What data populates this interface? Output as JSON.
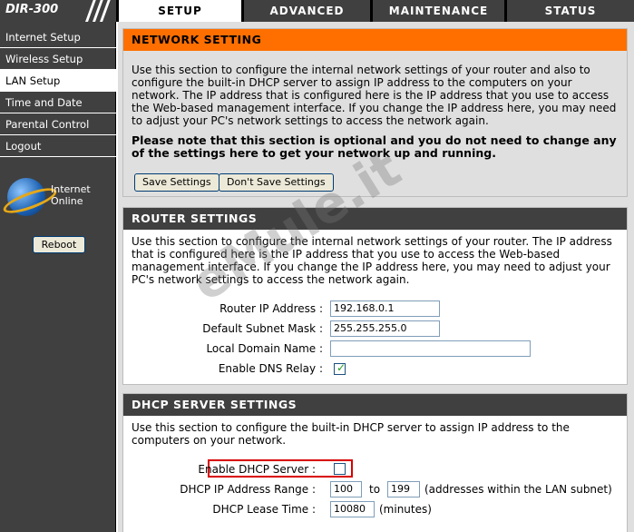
{
  "logo": "DIR-300",
  "tabs": [
    "SETUP",
    "ADVANCED",
    "MAINTENANCE",
    "STATUS"
  ],
  "sidebar": {
    "items": [
      "Internet Setup",
      "Wireless Setup",
      "LAN Setup",
      "Time and Date",
      "Parental Control",
      "Logout"
    ],
    "internet_status_line1": "Internet",
    "internet_status_line2": "Online",
    "reboot": "Reboot"
  },
  "network": {
    "title": "NETWORK SETTING",
    "description": "Use this section to configure the internal network settings of your router and also to configure the built-in DHCP server to assign IP address to the computers on your network. The IP address that is configured here is the IP address that you use to access the Web-based management interface. If you change the IP address here, you may need to adjust your PC's network settings to access the network again.",
    "note": "Please note that this section is optional and you do not need to change any of the settings here to get your network up and running.",
    "save": "Save Settings",
    "dont_save": "Don't Save Settings"
  },
  "router": {
    "title": "ROUTER SETTINGS",
    "description": "Use this section to configure the internal network settings of your router. The IP address that is configured here is the IP address that you use to access the Web-based management interface. If you change the IP address here, you may need to adjust your PC's network settings to access the network again.",
    "ip_label": "Router IP Address :",
    "ip_value": "192.168.0.1",
    "mask_label": "Default Subnet Mask :",
    "mask_value": "255.255.255.0",
    "domain_label": "Local Domain Name :",
    "domain_value": "",
    "dns_label": "Enable DNS Relay :",
    "dns_checked": true
  },
  "dhcp": {
    "title": "DHCP SERVER SETTINGS",
    "description": "Use this section to configure the built-in DHCP server to assign IP address to the computers on your network.",
    "enable_label": "Enable DHCP Server :",
    "enable_checked": false,
    "range_label": "DHCP IP Address Range :",
    "range_start": "100",
    "range_to": "to",
    "range_end": "199",
    "range_note": "(addresses within the LAN subnet)",
    "lease_label": "DHCP Lease Time :",
    "lease_value": "10080",
    "lease_unit": "(minutes)"
  },
  "watermark": "eMule.it"
}
